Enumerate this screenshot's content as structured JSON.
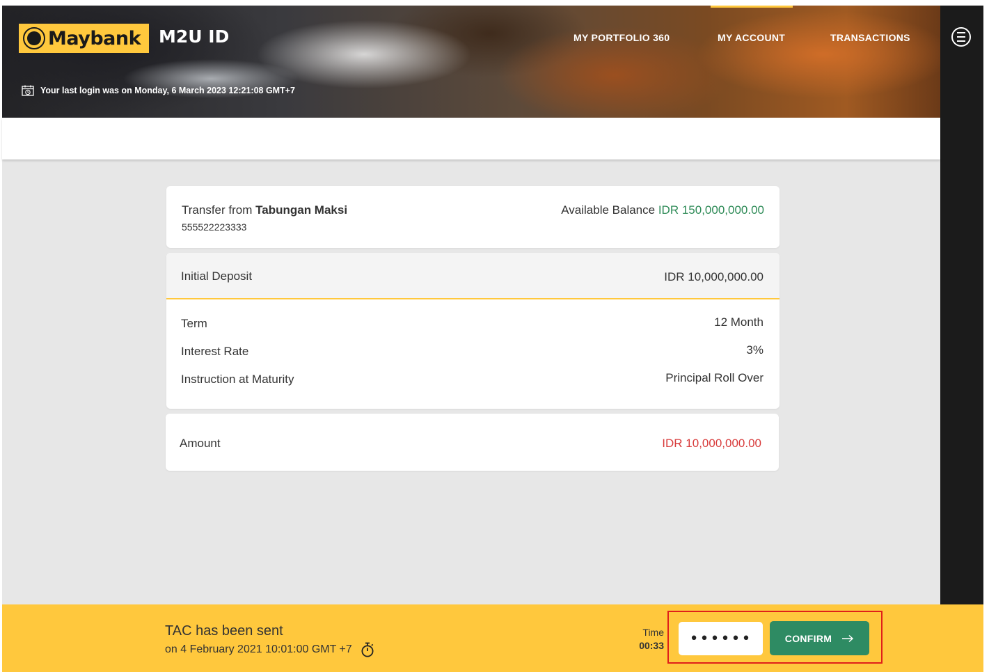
{
  "header": {
    "brand": "Maybank",
    "app_title": "M2U ID",
    "nav": [
      "MY PORTFOLIO 360",
      "MY ACCOUNT",
      "TRANSACTIONS"
    ],
    "active_nav": "MY ACCOUNT",
    "last_login": "Your last login was on Monday, 6 March 2023 12:21:08 GMT+7"
  },
  "source": {
    "label": "Transfer from",
    "account_name": "Tabungan Maksi",
    "account_number": "555522223333",
    "balance_label": "Available Balance",
    "balance_value": "IDR 150,000,000.00"
  },
  "deposit": {
    "initial_label": "Initial Deposit",
    "initial_value": "IDR 10,000,000.00",
    "rows": [
      {
        "label": "Term",
        "value": "12 Month"
      },
      {
        "label": "Interest Rate",
        "value": "3%"
      },
      {
        "label": "Instruction at Maturity",
        "value": "Principal Roll Over"
      }
    ]
  },
  "amount": {
    "label": "Amount",
    "value": "IDR 10,000,000.00"
  },
  "tac": {
    "title": "TAC has been sent",
    "sent_on": "on 4 February 2021 10:01:00 GMT +7",
    "time_label": "Time",
    "time_value": "00:33",
    "input_value": "••••••",
    "confirm_label": "CONFIRM"
  },
  "colors": {
    "brand_yellow": "#ffc83d",
    "positive_green": "#2e8b57",
    "amount_red": "#d83a3a",
    "button_green": "#2e8b63"
  }
}
